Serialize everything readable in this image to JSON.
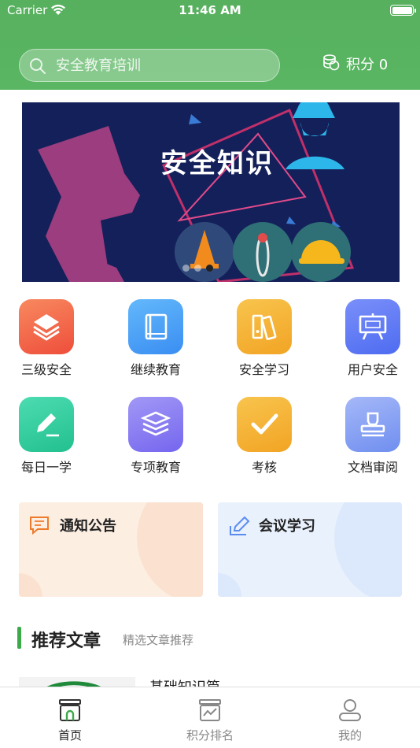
{
  "status_bar": {
    "carrier": "Carrier",
    "time": "11:46 AM"
  },
  "search": {
    "placeholder": "安全教育培训"
  },
  "points": {
    "label": "积分 0"
  },
  "banner": {
    "title": "安全知识",
    "slide_count": 3,
    "active_slide": 3
  },
  "grid": [
    {
      "label": "三级安全",
      "icon": "layers-icon",
      "color": "#f15a3c"
    },
    {
      "label": "继续教育",
      "icon": "book-icon",
      "color": "#3ea0f5"
    },
    {
      "label": "安全学习",
      "icon": "binders-icon",
      "color": "#f4b133"
    },
    {
      "label": "用户安全",
      "icon": "presentation-board-icon",
      "color": "#5b78f6"
    },
    {
      "label": "每日一学",
      "icon": "pencil-icon",
      "color": "#2fcd9e"
    },
    {
      "label": "专项教育",
      "icon": "stack-icon",
      "color": "#8a7df2"
    },
    {
      "label": "考核",
      "icon": "checkmark-icon",
      "color": "#f4b133"
    },
    {
      "label": "文档审阅",
      "icon": "stamp-icon",
      "color": "#7b9bf0"
    }
  ],
  "cards": [
    {
      "title": "通知公告",
      "icon": "message-icon"
    },
    {
      "title": "会议学习",
      "icon": "edit-icon"
    }
  ],
  "section": {
    "title": "推荐文章",
    "subtitle": "精选文章推荐"
  },
  "article": {
    "title": "基础知识篇"
  },
  "tabs": [
    {
      "label": "首页",
      "icon": "home-icon",
      "active": true
    },
    {
      "label": "积分排名",
      "icon": "ranking-icon",
      "active": false
    },
    {
      "label": "我的",
      "icon": "profile-icon",
      "active": false
    }
  ]
}
